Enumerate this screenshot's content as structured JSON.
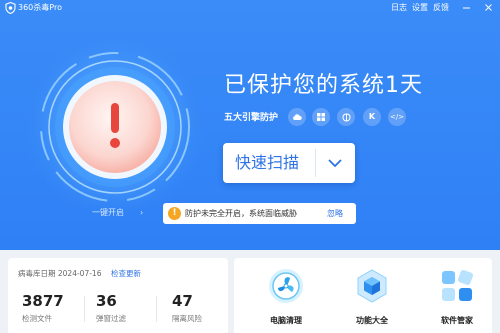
{
  "app": {
    "title": "360杀毒Pro"
  },
  "titlebar": {
    "log": "日志",
    "settings": "设置",
    "feedback": "反馈"
  },
  "status": {
    "title": "已保护您的系统1天",
    "engines_label": "五大引擎防护",
    "engines": [
      "cloud-engine-icon",
      "windows-engine-icon",
      "brain-engine-icon",
      "k-engine-icon",
      "code-engine-icon"
    ]
  },
  "scan": {
    "label": "快速扫描"
  },
  "onekey": {
    "label": "一键开启"
  },
  "warning": {
    "text": "防护未完全开启，系统面临威胁",
    "ignore": "忽略",
    "color": "#f5a623"
  },
  "database": {
    "label": "病毒库日期 2024-07-16",
    "update": "检查更新"
  },
  "stats": [
    {
      "value": "3877",
      "label": "检测文件"
    },
    {
      "value": "36",
      "label": "弹窗过滤"
    },
    {
      "value": "47",
      "label": "隔离风险"
    }
  ],
  "tools": [
    {
      "label": "电脑清理",
      "icon": "fan-clean-icon"
    },
    {
      "label": "功能大全",
      "icon": "cube-features-icon"
    },
    {
      "label": "软件管家",
      "icon": "software-manager-icon"
    }
  ],
  "colors": {
    "primary": "#2f80f5",
    "accent": "#2f73e6",
    "alert": "#e8453c"
  }
}
